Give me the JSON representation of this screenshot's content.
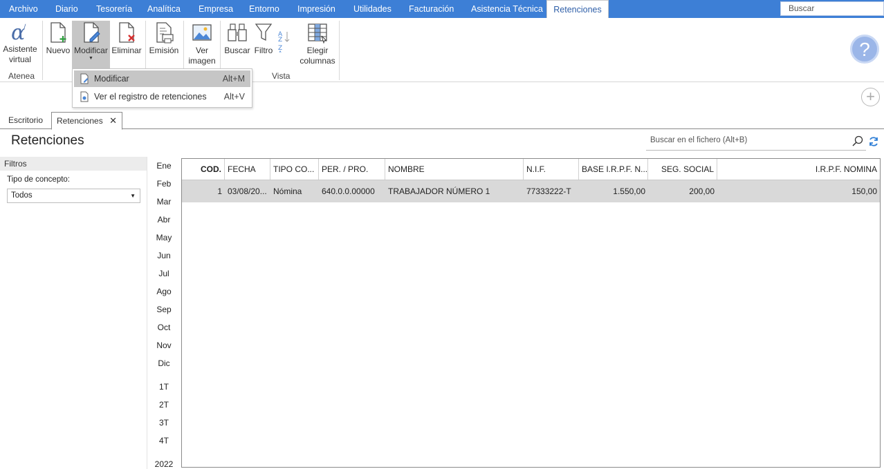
{
  "menu": {
    "items": [
      "Archivo",
      "Diario",
      "Tesorería",
      "Analítica",
      "Empresa",
      "Entorno",
      "Impresión",
      "Utilidades",
      "Facturación",
      "Asistencia Técnica",
      "Retenciones"
    ],
    "search_placeholder": "Buscar"
  },
  "ribbon": {
    "asistente": "Asistente virtual",
    "nuevo": "Nuevo",
    "modificar": "Modificar",
    "eliminar": "Eliminar",
    "emision": "Emisión",
    "ver_imagen": "Ver imagen",
    "buscar": "Buscar",
    "filtro": "Filtro",
    "elegir_columnas": "Elegir columnas",
    "groups": {
      "atenea": "Atenea",
      "vista": "Vista"
    }
  },
  "dropdown": {
    "items": [
      {
        "label": "Modificar",
        "shortcut": "Alt+M"
      },
      {
        "label": "Ver el registro de retenciones",
        "shortcut": "Alt+V"
      }
    ]
  },
  "tabs": [
    "Escritorio",
    "Retenciones"
  ],
  "page": {
    "title": "Retenciones",
    "search_placeholder": "Buscar en el fichero (Alt+B)"
  },
  "filters": {
    "header": "Filtros",
    "concept_label": "Tipo de concepto:",
    "concept_value": "Todos"
  },
  "periods": {
    "months": [
      "Ene",
      "Feb",
      "Mar",
      "Abr",
      "May",
      "Jun",
      "Jul",
      "Ago",
      "Sep",
      "Oct",
      "Nov",
      "Dic"
    ],
    "quarters": [
      "1T",
      "2T",
      "3T",
      "4T"
    ],
    "year": "2022"
  },
  "table": {
    "columns": [
      "COD.",
      "FECHA",
      "TIPO CO...",
      "PER. / PRO.",
      "NOMBRE",
      "N.I.F.",
      "BASE I.R.P.F. N...",
      "SEG. SOCIAL",
      "I.R.P.F. NOMINA"
    ],
    "rows": [
      [
        "1",
        "03/08/20...",
        "Nómina",
        "640.0.0.00000",
        "TRABAJADOR NÚMERO 1",
        "77333222-T",
        "1.550,00",
        "200,00",
        "150,00"
      ]
    ]
  },
  "colors": {
    "menubar": "#3d7fd6",
    "selected_row": "#d9d9d9"
  }
}
